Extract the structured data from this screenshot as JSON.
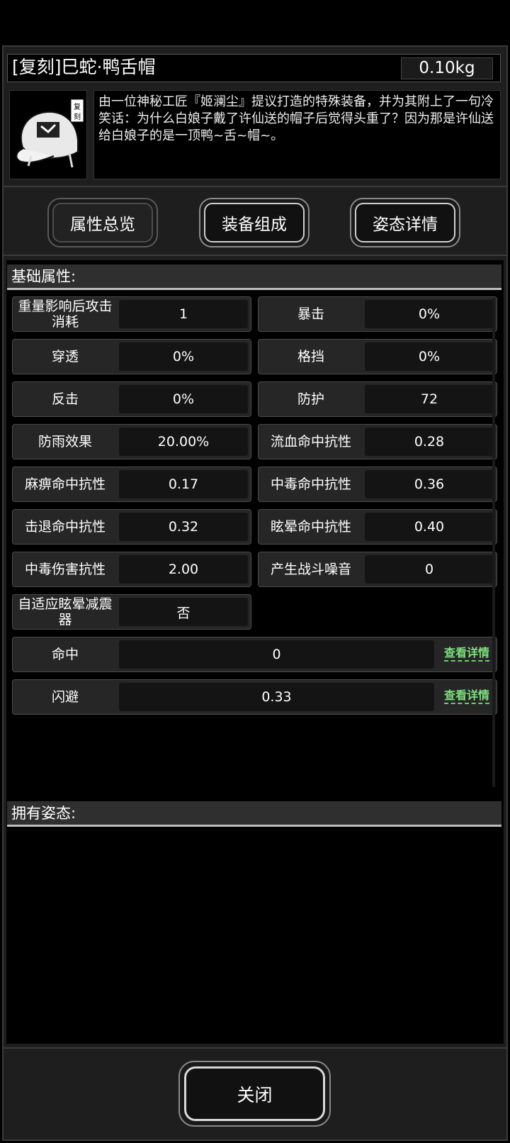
{
  "item": {
    "title": "[复刻]巳蛇·鸭舌帽",
    "weight": "0.10kg",
    "badge": "复刻",
    "description": "由一位神秘工匠『姬澜尘』提议打造的特殊装备，并为其附上了一句冷笑话：为什么白娘子戴了许仙送的帽子后觉得头重了？因为那是许仙送给白娘子的是一顶鸭~舌~帽~。",
    "icon": "cap-icon"
  },
  "tabs": [
    {
      "label": "属性总览",
      "active": true
    },
    {
      "label": "装备组成",
      "active": false
    },
    {
      "label": "姿态详情",
      "active": false
    }
  ],
  "sections": {
    "basic": "基础属性:",
    "stances": "拥有姿态:"
  },
  "stats": [
    {
      "label": "重量影响后攻击消耗",
      "value": "1"
    },
    {
      "label": "暴击",
      "value": "0%"
    },
    {
      "label": "穿透",
      "value": "0%"
    },
    {
      "label": "格挡",
      "value": "0%"
    },
    {
      "label": "反击",
      "value": "0%"
    },
    {
      "label": "防护",
      "value": "72"
    },
    {
      "label": "防雨效果",
      "value": "20.00%"
    },
    {
      "label": "流血命中抗性",
      "value": "0.28"
    },
    {
      "label": "麻痹命中抗性",
      "value": "0.17"
    },
    {
      "label": "中毒命中抗性",
      "value": "0.36"
    },
    {
      "label": "击退命中抗性",
      "value": "0.32"
    },
    {
      "label": "眩晕命中抗性",
      "value": "0.40"
    },
    {
      "label": "中毒伤害抗性",
      "value": "2.00"
    },
    {
      "label": "产生战斗噪音",
      "value": "0"
    },
    {
      "label": "自适应眩晕减震器",
      "value": "否"
    }
  ],
  "wide_stats": [
    {
      "label": "命中",
      "value": "0",
      "link": "查看详情"
    },
    {
      "label": "闪避",
      "value": "0.33",
      "link": "查看详情"
    }
  ],
  "close_label": "关闭"
}
